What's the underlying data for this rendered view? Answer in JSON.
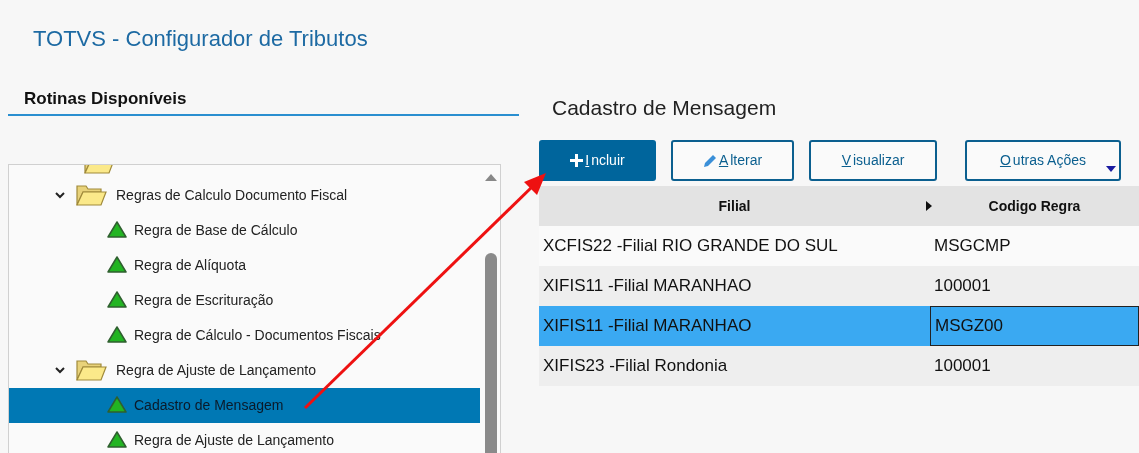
{
  "title": "TOTVS - Configurador de Tributos",
  "sidebar": {
    "heading": "Rotinas Disponíveis",
    "tree": [
      {
        "label": "Regras de Calculo Documento Fiscal",
        "expanded": true,
        "children": [
          {
            "label": "Regra de Base de Cálculo",
            "selected": false
          },
          {
            "label": "Regra de Alíquota",
            "selected": false
          },
          {
            "label": "Regra de Escrituração",
            "selected": false
          },
          {
            "label": "Regra de Cálculo - Documentos Fiscais",
            "selected": false
          }
        ]
      },
      {
        "label": "Regra de Ajuste de Lançamento",
        "expanded": true,
        "children": [
          {
            "label": "Cadastro de Mensagem",
            "selected": true
          },
          {
            "label": "Regra de Ajuste de Lançamento",
            "selected": false
          }
        ]
      }
    ]
  },
  "main": {
    "heading": "Cadastro de Mensagem",
    "buttons": [
      {
        "label": "Incluir",
        "kind": "primary"
      },
      {
        "label": "Alterar",
        "kind": "edit"
      },
      {
        "label": "Visualizar",
        "kind": "plain"
      },
      {
        "label": "Outras Ações",
        "kind": "menu"
      }
    ],
    "table": {
      "columns": [
        "Filial",
        "Codigo Regra"
      ],
      "rows": [
        {
          "cells": [
            "XCFIS22 -Filial RIO GRANDE DO SUL",
            "MSGCMP"
          ],
          "selected": false
        },
        {
          "cells": [
            "XIFIS11 -Filial MARANHAO",
            "100001"
          ],
          "selected": false
        },
        {
          "cells": [
            "XIFIS11 -Filial MARANHAO",
            "MSGZ00"
          ],
          "selected": true
        },
        {
          "cells": [
            "XIFIS23 -Filial Rondonia",
            "100001"
          ],
          "selected": false
        }
      ]
    }
  }
}
